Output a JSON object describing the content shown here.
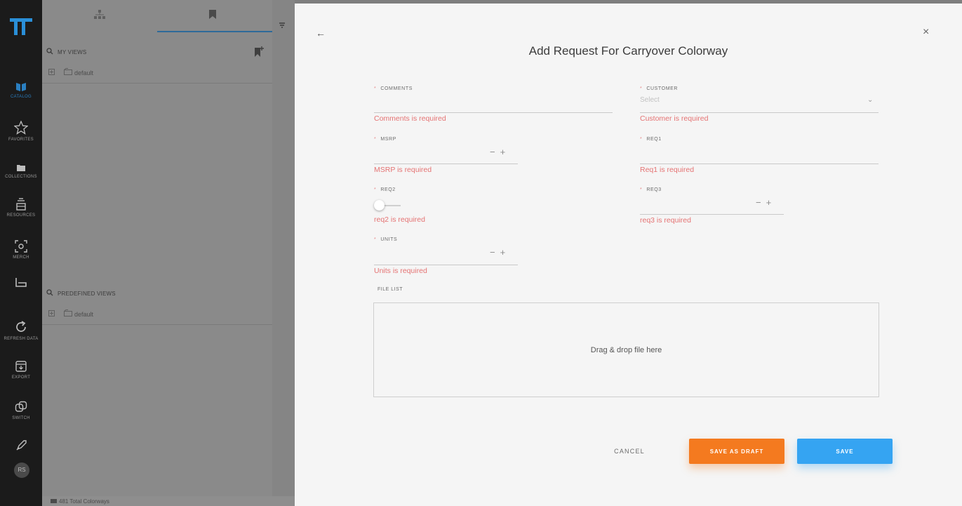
{
  "nav": {
    "items": [
      {
        "label": "CATALOG",
        "icon": "catalog-icon",
        "active": true
      },
      {
        "label": "FAVORITES",
        "icon": "star-icon"
      },
      {
        "label": "COLLECTIONS",
        "icon": "folder-icon"
      },
      {
        "label": "RESOURCES",
        "icon": "resources-icon"
      },
      {
        "label": "MERCH",
        "icon": "merch-icon"
      },
      {
        "label": "",
        "icon": "hanger-icon"
      },
      {
        "label": "REFRESH DATA",
        "icon": "refresh-icon"
      },
      {
        "label": "EXPORT",
        "icon": "export-icon"
      },
      {
        "label": "SWITCH",
        "icon": "switch-icon"
      },
      {
        "label": "",
        "icon": "rocket-icon"
      }
    ],
    "avatar": "RS",
    "accent": "#2a7fc1"
  },
  "views": {
    "my_views_title": "MY VIEWS",
    "my_views_items": [
      "default"
    ],
    "predefined_title": "PREDEFINED VIEWS",
    "predefined_items": [
      "default"
    ],
    "footer": "481 Total Colorways"
  },
  "modal": {
    "title": "Add Request For Carryover Colorway",
    "fields": {
      "comments": {
        "label": "COMMENTS",
        "error": "Comments is required"
      },
      "customer": {
        "label": "CUSTOMER",
        "placeholder": "Select",
        "error": "Customer is required"
      },
      "msrp": {
        "label": "MSRP",
        "error": "MSRP is required"
      },
      "req1": {
        "label": "REQ1",
        "error": "Req1 is required"
      },
      "req2": {
        "label": "REQ2",
        "error": "req2 is required"
      },
      "req3": {
        "label": "REQ3",
        "error": "req3 is required"
      },
      "units": {
        "label": "UNITS",
        "error": "Units is required"
      }
    },
    "stepper_minus": "−",
    "stepper_plus": "+",
    "required_mark": "*",
    "file_list_label": "FILE LIST",
    "dropzone_text": "Drag & drop file here",
    "buttons": {
      "cancel": "CANCEL",
      "save_draft": "SAVE AS DRAFT",
      "save": "SAVE"
    },
    "colors": {
      "error": "#e57373",
      "draft": "#f47a1f",
      "save": "#35a4f2"
    }
  }
}
